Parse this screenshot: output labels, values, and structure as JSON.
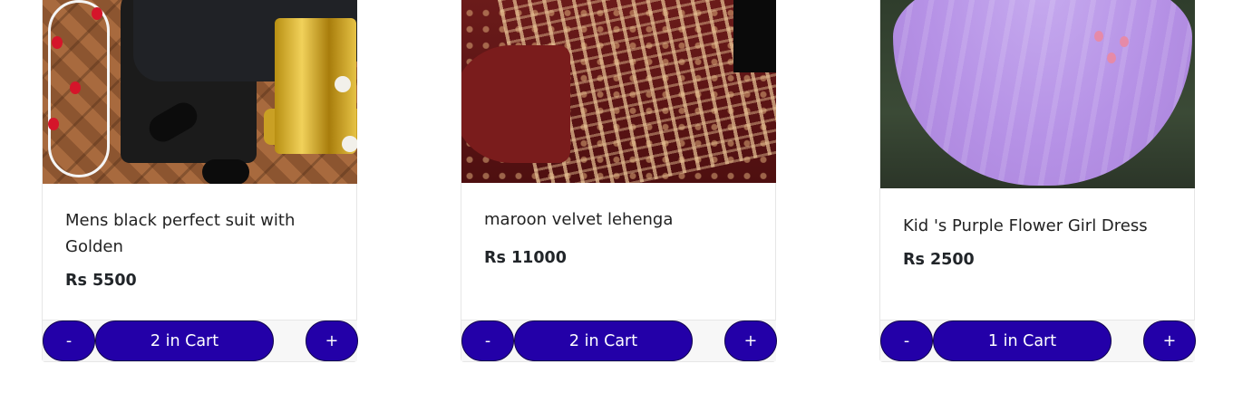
{
  "products": [
    {
      "title": "Mens black perfect suit with Golden",
      "price": "Rs 5500",
      "image": "mens black suit photo",
      "controls": {
        "minus": "-",
        "cart": "2 in Cart",
        "plus": "+"
      }
    },
    {
      "title": "maroon velvet lehenga",
      "price": "Rs 11000",
      "image": "maroon velvet lehenga photo",
      "controls": {
        "minus": "-",
        "cart": "2 in Cart",
        "plus": "+"
      }
    },
    {
      "title": "Kid 's Purple Flower Girl Dress",
      "price": "Rs 2500",
      "image": "purple flower girl dress photo",
      "controls": {
        "minus": "-",
        "cart": "1 in Cart",
        "plus": "+"
      }
    }
  ],
  "colors": {
    "button_bg": "#2300a8",
    "button_text": "#ffffff",
    "footer_bg": "#f7f7f7",
    "card_border": "#e6e6e6"
  }
}
